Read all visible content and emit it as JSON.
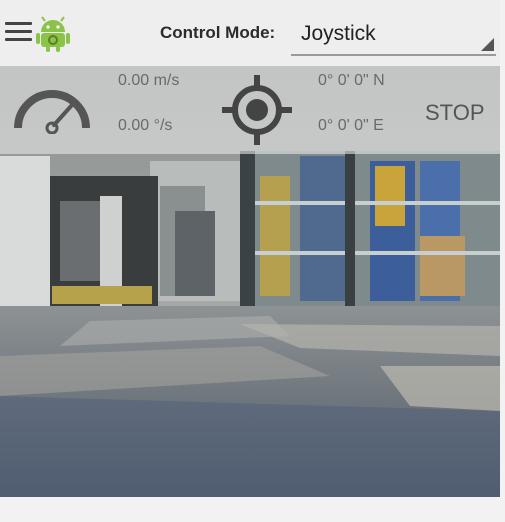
{
  "toolbar": {
    "menu_icon": "hamburger-menu-icon",
    "logo_icon": "android-robot-icon",
    "control_mode_label": "Control Mode:",
    "control_mode_value": "Joystick"
  },
  "telemetry": {
    "speed": "0.00 m/s",
    "yaw_rate": "0.00 °/s",
    "latitude": "0° 0' 0\" N",
    "longitude": "0° 0' 0\" E",
    "stop_label": "STOP",
    "gauge_icon": "speedometer-icon",
    "target_icon": "gps-target-icon"
  }
}
